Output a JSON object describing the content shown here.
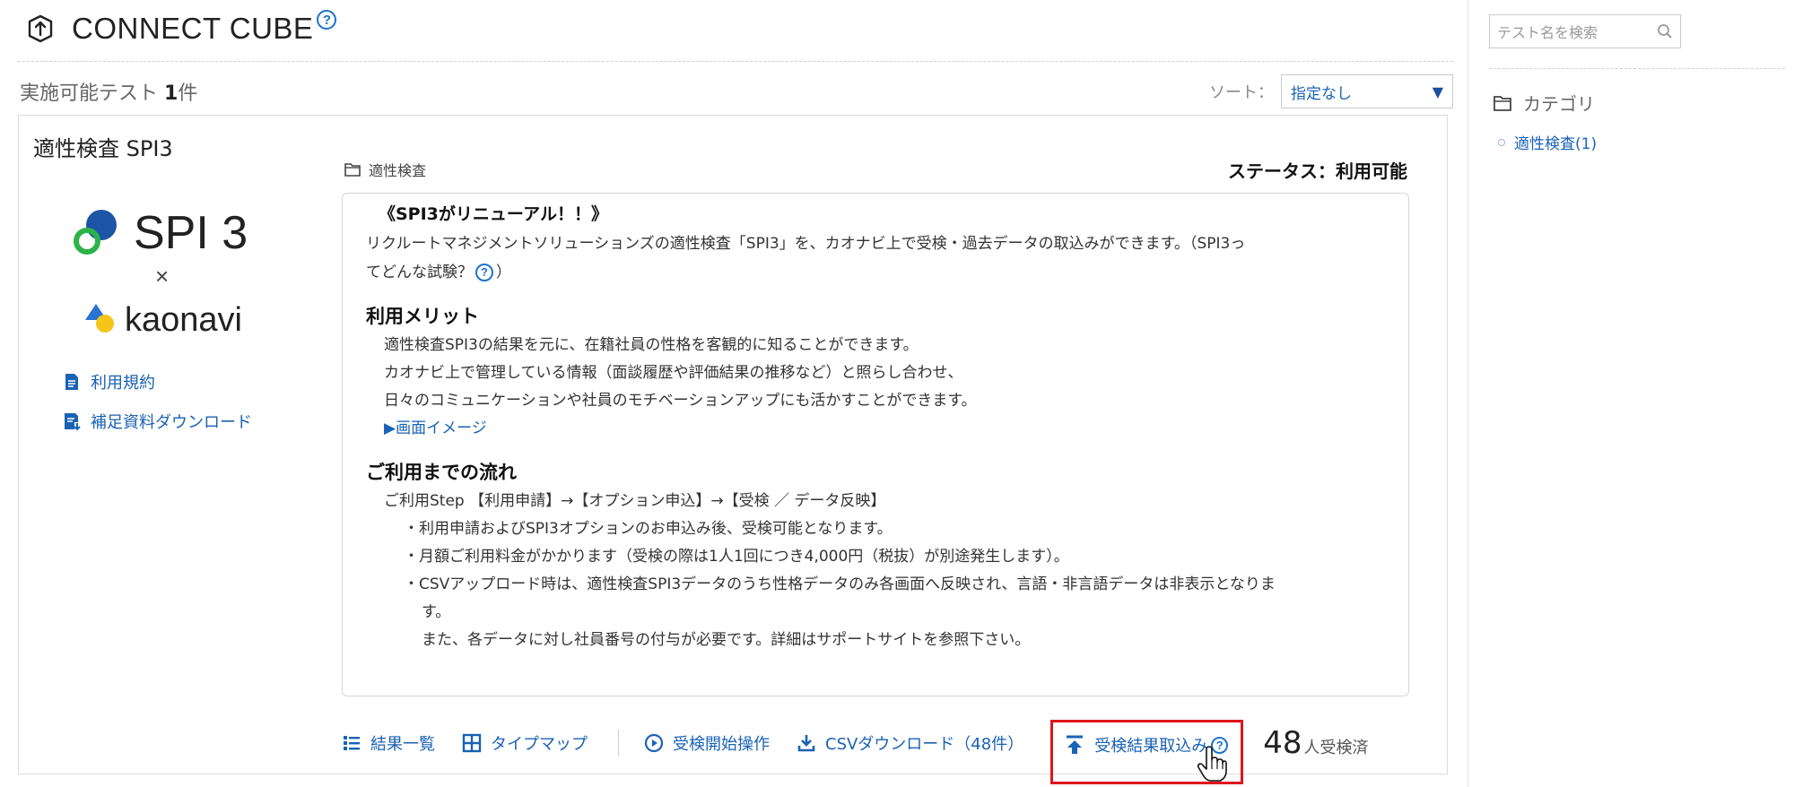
{
  "header": {
    "title": "CONNECT CUBE",
    "help_glyph": "?"
  },
  "list": {
    "count_prefix": "実施可能テスト ",
    "count_value": "1",
    "count_suffix": "件",
    "sort_label": "ソート：",
    "sort_selected": "指定なし"
  },
  "card": {
    "title": "適性検査 SPI3",
    "logo": {
      "spi": "SPI 3",
      "times": "×",
      "kaonavi": "kaonavi"
    },
    "links": [
      {
        "label": "利用規約",
        "icon": "document-icon"
      },
      {
        "label": "補足資料ダウンロード",
        "icon": "download-document-icon"
      }
    ],
    "category": "適性検査",
    "status": "ステータス：利用可能",
    "description": {
      "headline": "《SPI3がリニューアル！！》",
      "intro_1": "リクルートマネジメントソリューションズの適性検査「SPI3」を、カオナビ上で受検・過去データの取込みができます。（SPI3っ",
      "intro_2": "てどんな試験？",
      "intro_2_end": "）",
      "merit_title": "利用メリット",
      "merit_lines": [
        "適性検査SPI3の結果を元に、在籍社員の性格を客観的に知ることができます。",
        "カオナビ上で管理している情報（面談履歴や評価結果の推移など）と照らし合わせ、",
        "日々のコミュニケーションや社員のモチベーションアップにも活かすことができます。"
      ],
      "image_link": "▶画面イメージ",
      "flow_title": "ご利用までの流れ",
      "flow_step": "ご利用Step 【利用申請】→【オプション申込】→【受検 ／ データ反映】",
      "flow_lines": [
        "・利用申請およびSPI3オプションのお申込み後、受検可能となります。",
        "・月額ご利用料金がかかります（受検の際は1人1回につき4,000円（税抜）が別途発生します）。",
        "・CSVアップロード時は、適性検査SPI3データのうち性格データのみ各画面へ反映され、言語・非言語データは非表示となりま"
      ],
      "flow_cont_1": "す。",
      "flow_cont_2": "また、各データに対し社員番号の付与が必要です。詳細はサポートサイトを参照下さい。"
    },
    "toolbar": {
      "results": "結果一覧",
      "typemap": "タイプマップ",
      "start": "受検開始操作",
      "csv": "CSVダウンロード（48件）",
      "import": "受検結果取込み",
      "taken_count": "48",
      "taken_unit": "人受検済"
    }
  },
  "sidebar": {
    "search_placeholder": "テスト名を検索",
    "category_heading": "カテゴリ",
    "categories": [
      {
        "label": "適性検査(1)"
      }
    ]
  },
  "colors": {
    "link": "#1a62b5",
    "highlight_border": "#e0141c",
    "help": "#1a73c9"
  }
}
